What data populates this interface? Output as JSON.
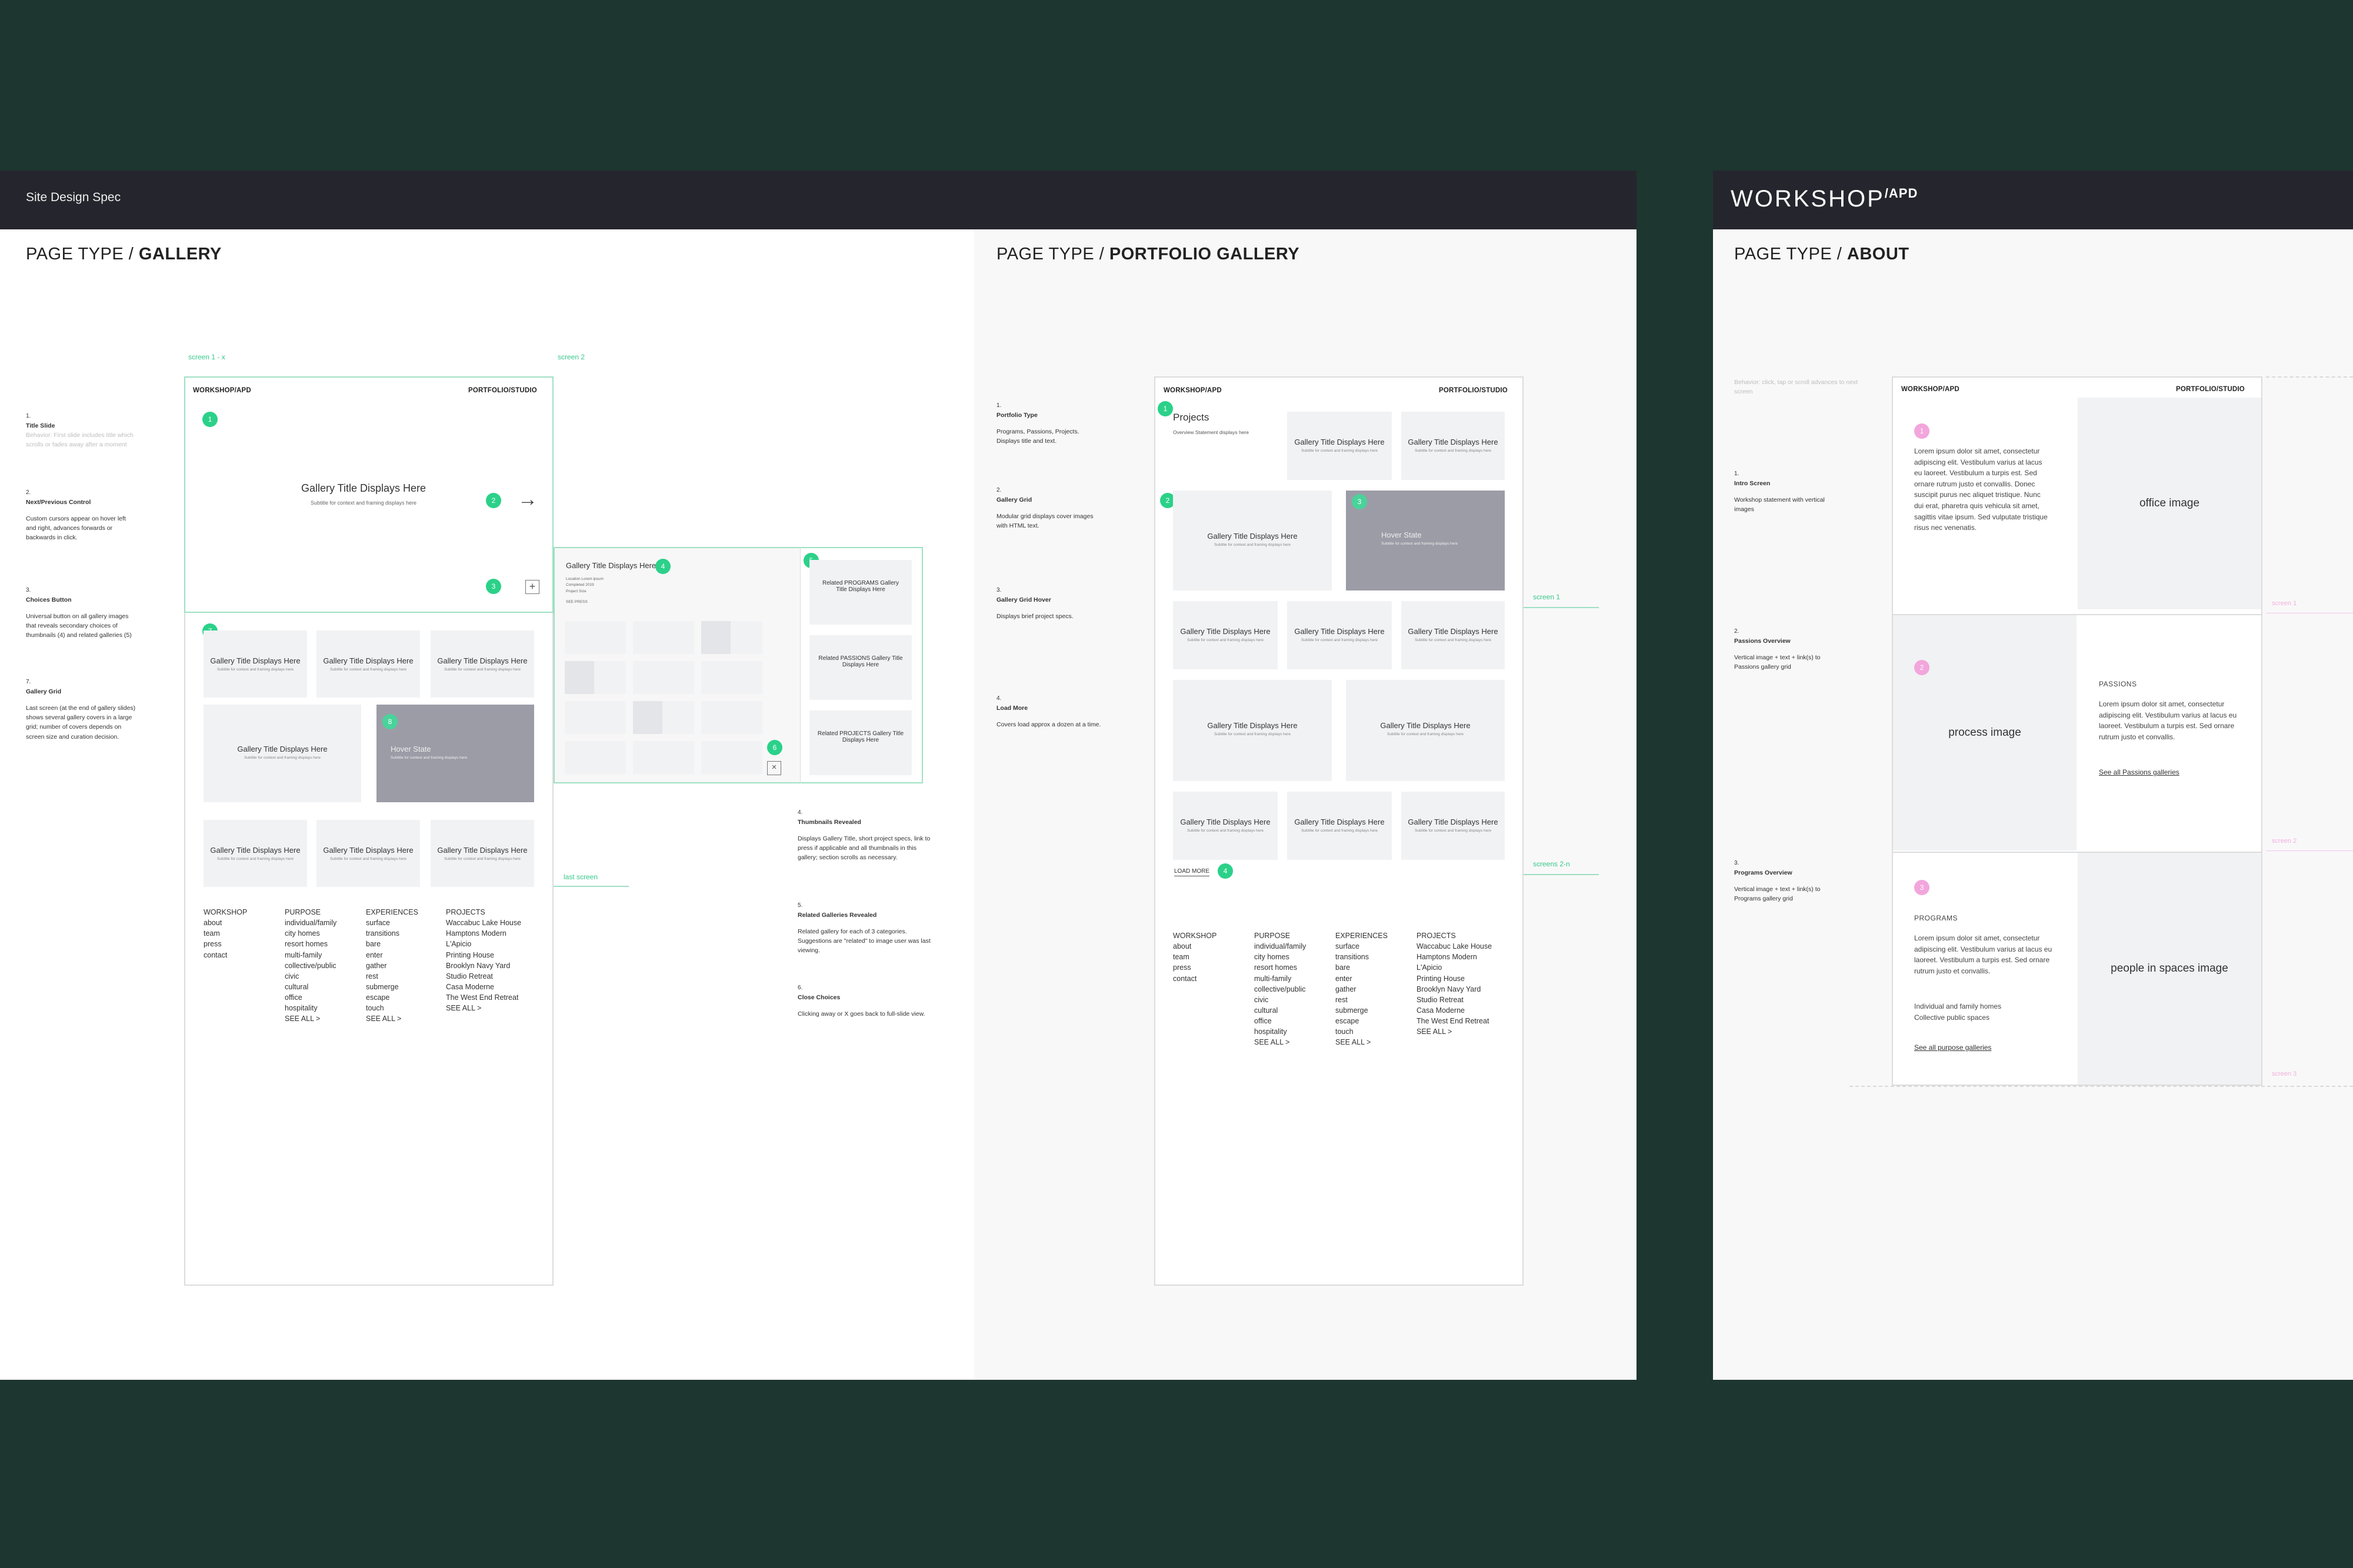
{
  "board1": {
    "header": "Site Design Spec",
    "gallery": {
      "page_type": "PAGE TYPE",
      "page_name": "GALLERY",
      "annotations": [
        {
          "num": "1.",
          "title": "Title Slide",
          "desc": "Behavior: First slide includes title which scrolls or fades away after a moment",
          "muted": true
        },
        {
          "num": "2.",
          "title": "Next/Previous Control",
          "desc": "Custom cursors appear on hover left and right, advances forwards or backwards in click."
        },
        {
          "num": "3.",
          "title": "Choices Button",
          "desc": "Universal button on all gallery images that reveals secondary choices of thumbnails (4) and related galleries (5)"
        },
        {
          "num": "7.",
          "title": "Gallery Grid",
          "desc": "Last screen (at the end of gallery slides) shows several gallery covers in a large grid; number of covers depends on screen size and curation decision."
        }
      ],
      "annotations_right": [
        {
          "num": "4.",
          "title": "Thumbnails Revealed",
          "desc": "Displays Gallery Title, short project specs, link to press if applicable and all thumbnails in this gallery; section scrolls as necessary."
        },
        {
          "num": "5.",
          "title": "Related Galleries Revealed",
          "desc": "Related gallery for each of 3 categories. Suggestions are \"related\" to image user was last viewing."
        },
        {
          "num": "6.",
          "title": "Close Choices",
          "desc": "Clicking away or X goes back to full-slide view."
        }
      ],
      "screen_label_1": "screen 1 - x",
      "screen_label_2": "screen 2",
      "last_screen": "last screen",
      "logo": "WORKSHOP/APD",
      "nav": "PORTFOLIO/STUDIO",
      "slide_title": "Gallery Title Displays Here",
      "slide_sub": "Subtitle for context and framing displays here",
      "thumb_title": "Gallery Title Displays Here",
      "thumb_specs": [
        "Location Lorem ipsum",
        "Completed 2019",
        "Project Size"
      ],
      "thumb_press": "SEE PRESS",
      "related": [
        "Related PROGRAMS Gallery Title Displays Here",
        "Related PASSIONS Gallery Title Displays Here",
        "Related PROJECTS Gallery Title Displays Here"
      ],
      "tile_title": "Gallery Title Displays Here",
      "tile_sub": "Subtitle for context and framing displays here",
      "hover_title": "Hover State",
      "hover_sub": "Subtitle for context and framing displays here",
      "dots": [
        "1",
        "2",
        "3",
        "4",
        "5",
        "6",
        "7",
        "8"
      ]
    },
    "portfolio": {
      "page_type": "PAGE TYPE",
      "page_name": "PORTFOLIO GALLERY",
      "annotations": [
        {
          "num": "1.",
          "title": "Portfolio Type",
          "desc": "Programs, Passions, Projects. Displays title and text."
        },
        {
          "num": "2.",
          "title": "Gallery Grid",
          "desc": "Modular grid displays cover images with HTML text."
        },
        {
          "num": "3.",
          "title": "Gallery Grid Hover",
          "desc": "Displays brief project specs."
        },
        {
          "num": "4.",
          "title": "Load More",
          "desc": "Covers load approx a dozen at a time."
        }
      ],
      "logo": "WORKSHOP/APD",
      "nav": "PORTFOLIO/STUDIO",
      "projects_title": "Projects",
      "projects_sub": "Overview Statement displays here",
      "load_more": "LOAD MORE",
      "screen_1": "screen 1",
      "screen_2n": "screens 2-n",
      "dots": [
        "1",
        "2",
        "3",
        "4"
      ]
    },
    "footer": {
      "cols": [
        {
          "head": "WORKSHOP",
          "items": [
            "about",
            "team",
            "press",
            "contact"
          ]
        },
        {
          "head": "PURPOSE",
          "items": [
            "individual/family",
            "city homes",
            "resort homes",
            "multi-family",
            "collective/public",
            "civic",
            "cultural",
            "office",
            "hospitality",
            "SEE ALL >"
          ]
        },
        {
          "head": "EXPERIENCES",
          "items": [
            "surface",
            "transitions",
            "bare",
            "enter",
            "gather",
            "rest",
            "submerge",
            "escape",
            "touch",
            "SEE ALL >"
          ]
        },
        {
          "head": "PROJECTS",
          "items": [
            "Waccabuc Lake House",
            "Hamptons Modern",
            "L'Apicio",
            "Printing House",
            "Brooklyn Navy Yard",
            "Studio Retreat",
            "Casa Moderne",
            "The West End Retreat",
            "SEE ALL >"
          ]
        }
      ]
    }
  },
  "board2": {
    "logo_main": "WORKSHOP",
    "logo_sup": "/APD",
    "page_type": "PAGE TYPE",
    "page_name": "ABOUT",
    "behavior": "Behavior: click, tap or scroll advances to next screen",
    "annotations": [
      {
        "num": "1.",
        "title": "Intro Screen",
        "desc": "Workshop statement with vertical images"
      },
      {
        "num": "2.",
        "title": "Passions Overview",
        "desc": "Vertical image + text + link(s) to Passions gallery grid"
      },
      {
        "num": "3.",
        "title": "Programs Overview",
        "desc": "Vertical image + text + link(s) to Programs gallery grid"
      }
    ],
    "logo": "WORKSHOP/APD",
    "nav": "PORTFOLIO/STUDIO",
    "intro_text": "Lorem ipsum dolor sit amet, consectetur adipiscing elit. Vestibulum varius at lacus eu laoreet. Vestibulum a turpis est. Sed ornare rutrum justo et convallis. Donec suscipit purus nec aliquet tristique. Nunc dui erat, pharetra quis vehicula sit amet, sagittis vitae ipsum. Sed vulputate tristique risus nec venenatis.",
    "office_image": "office image",
    "process_image": "process image",
    "people_image": "people in spaces image",
    "passions_head": "PASSIONS",
    "passions_text": "Lorem ipsum dolor sit amet, consectetur adipiscing elit. Vestibulum varius at lacus eu laoreet. Vestibulum a turpis est. Sed ornare rutrum justo et convallis.",
    "passions_link": "See all Passions galleries",
    "programs_head": "PROGRAMS",
    "programs_text": "Lorem ipsum dolor sit amet, consectetur adipiscing elit. Vestibulum varius at lacus eu laoreet. Vestibulum a turpis est. Sed ornare rutrum justo et convallis.",
    "programs_items": [
      "Individual and family homes",
      "Collective public spaces"
    ],
    "programs_link": "See all purpose galleries",
    "screen_labels": [
      "screen 1",
      "screen 2",
      "screen 3"
    ],
    "dots": [
      "1",
      "2",
      "3"
    ]
  },
  "colors": {
    "background": "#1e3630",
    "header_bar": "#25252d",
    "accent_green": "#2bd189",
    "accent_pink": "#f2a6dc",
    "hover_tile": "#9c9ca7"
  }
}
